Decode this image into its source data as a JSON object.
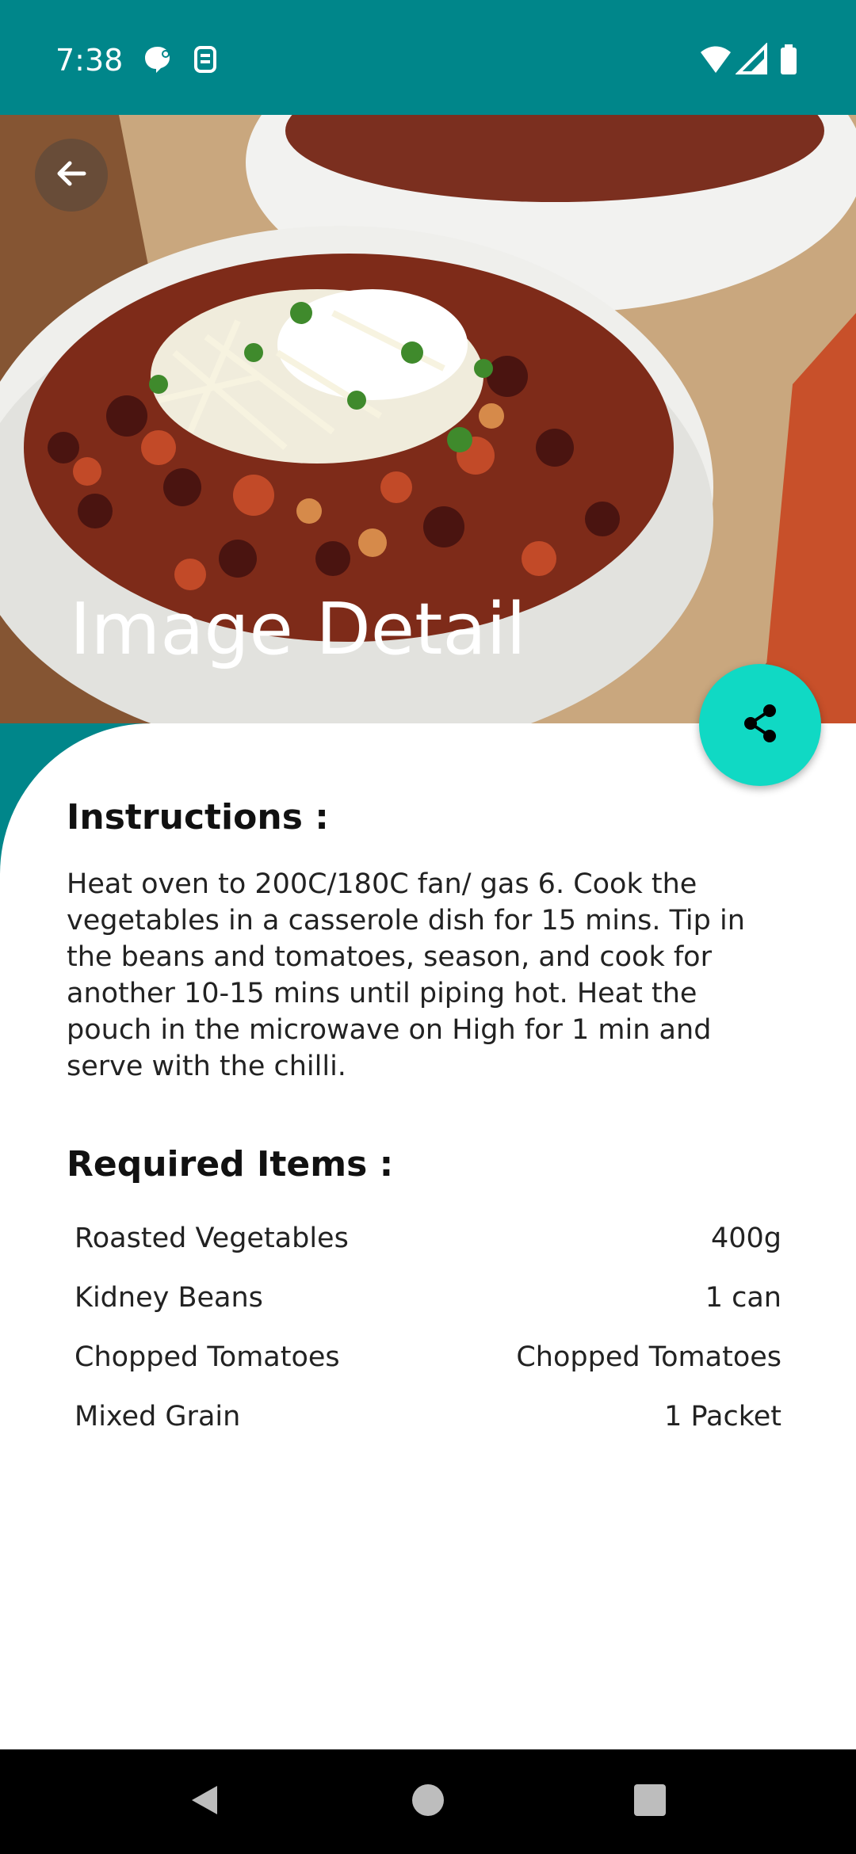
{
  "status_bar": {
    "time": "7:38",
    "left_icons": [
      "chat-notification-icon",
      "sim-icon"
    ],
    "right_icons": [
      "wifi-icon",
      "signal-icon",
      "battery-icon"
    ],
    "background": "#00868a"
  },
  "header": {
    "title": "Image Detail",
    "back_icon": "arrow-back-icon",
    "share_icon": "share-icon",
    "fab_color": "#10d9c4"
  },
  "instructions": {
    "heading": "Instructions :",
    "text": "Heat oven to 200C/180C fan/ gas 6. Cook the vegetables in a casserole dish for 15 mins. Tip in the beans and tomatoes, season, and cook for another 10-15 mins until piping hot. Heat the pouch in the microwave on High for 1 min and serve with the chilli."
  },
  "required_items": {
    "heading": "Required Items :",
    "items": [
      {
        "name": "Roasted Vegetables",
        "quantity": "400g"
      },
      {
        "name": "Kidney Beans",
        "quantity": "1 can"
      },
      {
        "name": "Chopped Tomatoes",
        "quantity": "Chopped Tomatoes"
      },
      {
        "name": "Mixed Grain",
        "quantity": "1 Packet"
      }
    ]
  },
  "nav_bar": {
    "buttons": [
      "back-triangle-icon",
      "home-circle-icon",
      "recents-square-icon"
    ]
  }
}
